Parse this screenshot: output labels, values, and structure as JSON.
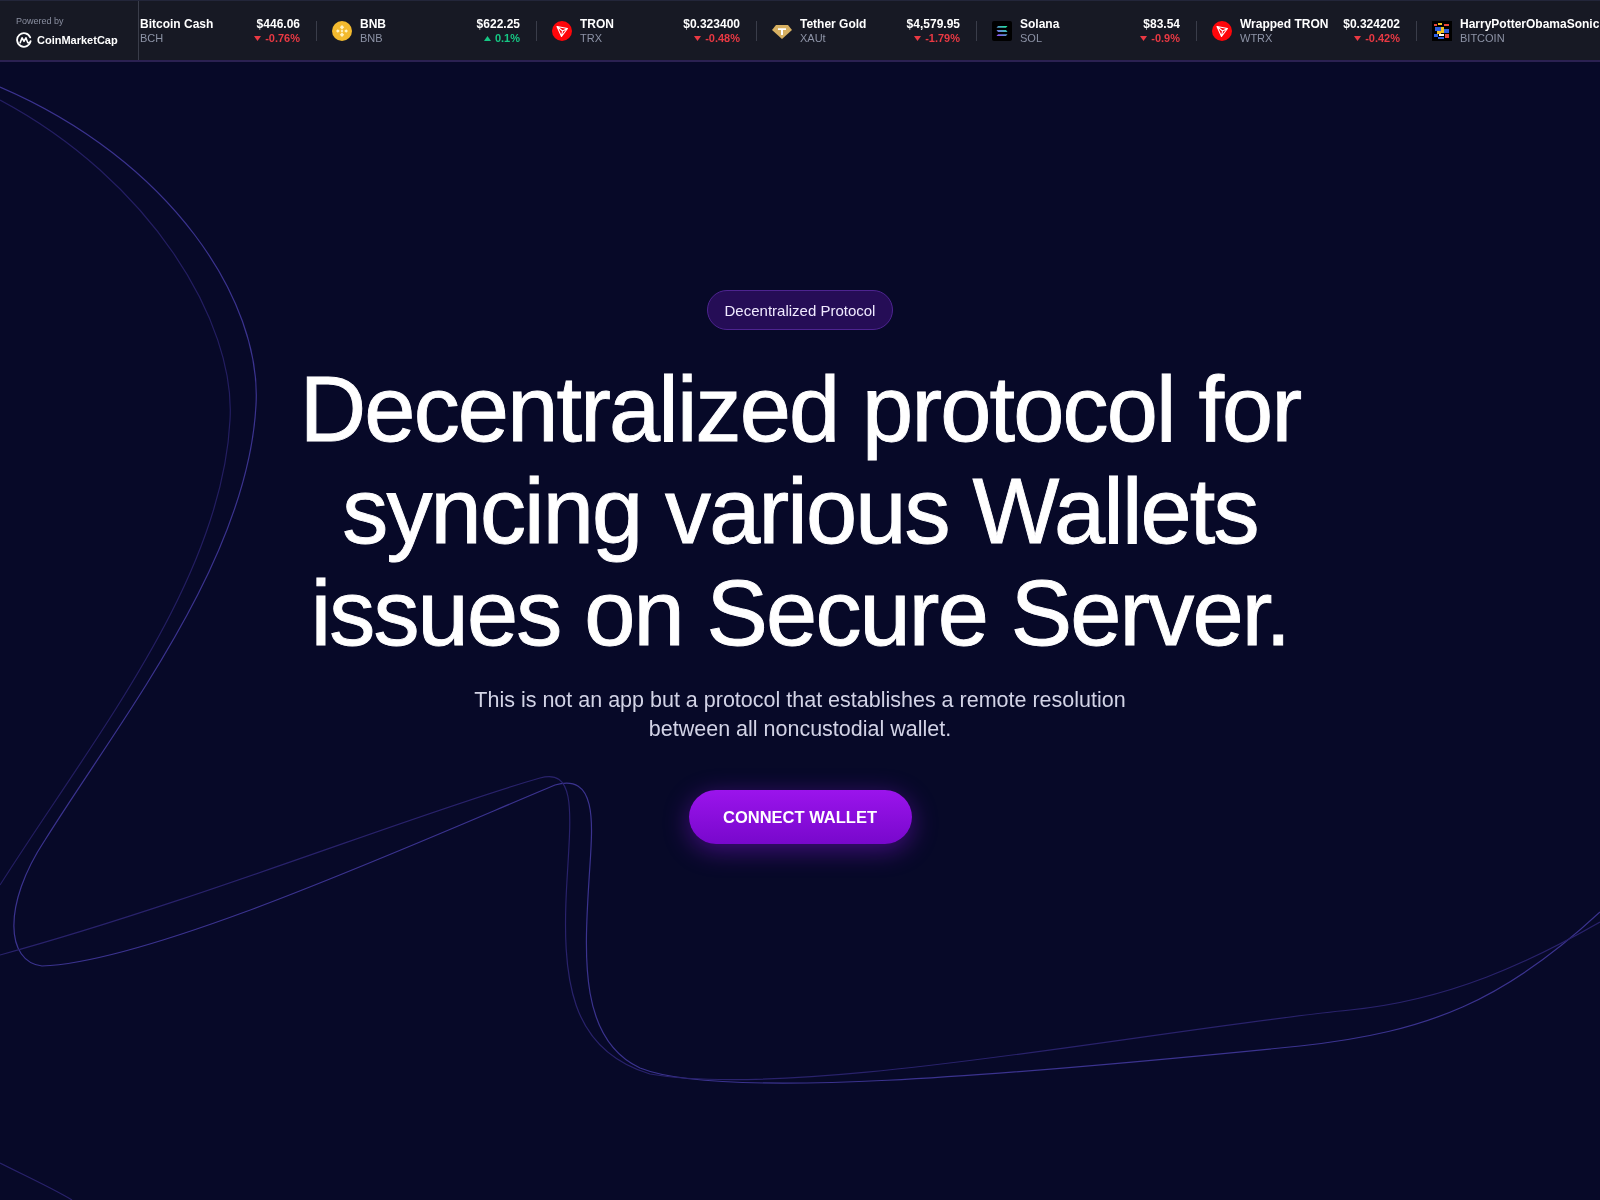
{
  "ticker": {
    "attribution": {
      "label": "Powered by",
      "brand": "CoinMarketCap"
    },
    "items": [
      {
        "kind": "plain",
        "name": "Bitcoin Cash",
        "symbol": "BCH",
        "price": "$446.06",
        "change": "-0.76%",
        "rising": false
      },
      {
        "kind": "logo",
        "name": "BNB",
        "symbol": "BNB",
        "price": "$622.25",
        "change": "0.1%",
        "rising": true
      },
      {
        "kind": "logo",
        "name": "TRON",
        "symbol": "TRX",
        "price": "$0.323400",
        "change": "-0.48%",
        "rising": false
      },
      {
        "kind": "logo",
        "name": "Tether Gold",
        "symbol": "XAUt",
        "price": "$4,579.95",
        "change": "-1.79%",
        "rising": false
      },
      {
        "kind": "logo",
        "name": "Solana",
        "symbol": "SOL",
        "price": "$83.54",
        "change": "-0.9%",
        "rising": false
      },
      {
        "kind": "logo",
        "name": "Wrapped TRON",
        "symbol": "WTRX",
        "price": "$0.324202",
        "change": "-0.42%",
        "rising": false
      },
      {
        "kind": "logo",
        "name": "HarryPotterObamaSonic",
        "symbol": "BITCOIN"
      }
    ]
  },
  "hero": {
    "badge": "Decentralized Protocol",
    "headline": "Decentralized protocol for syncing various Wallets issues on Secure Server.",
    "subtitle": "This is not an app but a protocol that establishes a remote resolution between all noncustodial wallet.",
    "button": "CONNECT WALLET"
  }
}
